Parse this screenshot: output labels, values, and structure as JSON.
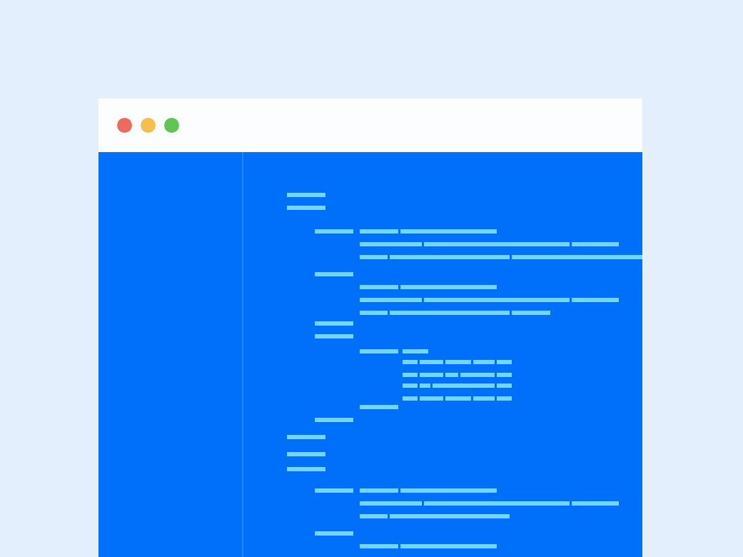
{
  "window": {
    "controls": [
      {
        "color": "#ed6a5e"
      },
      {
        "color": "#f5bf4f"
      },
      {
        "color": "#61c554"
      }
    ]
  }
}
